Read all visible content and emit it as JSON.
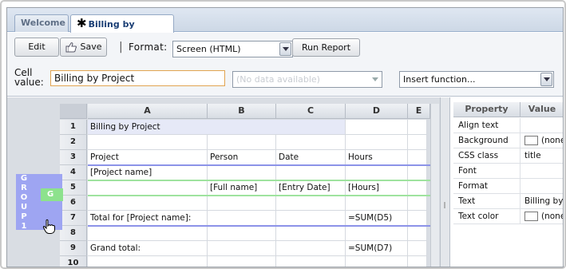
{
  "tabs": [
    {
      "label": "Welcome",
      "active": false
    },
    {
      "label": "Billing by Project",
      "active": true,
      "modified": true
    }
  ],
  "toolbar": {
    "edit_label": "Edit",
    "save_label": "Save",
    "separator": "|",
    "format_label": "Format:",
    "format_value": "Screen (HTML)",
    "run_label": "Run Report"
  },
  "cell_value": {
    "label_line1": "Cell",
    "label_line2": "value:",
    "value": "Billing by Project",
    "data_select": "(No data available)",
    "insert_function": "Insert function..."
  },
  "grid": {
    "columns": [
      "A",
      "B",
      "C",
      "D",
      "E"
    ],
    "rows": [
      "1",
      "2",
      "3",
      "4",
      "5",
      "6",
      "7",
      "8",
      "9",
      "10"
    ],
    "cells": {
      "r1a": "Billing by Project",
      "r3a": "Project",
      "r3b": "Person",
      "r3c": "Date",
      "r3d": "Hours",
      "r4a": "[Project name]",
      "r5b": "[Full name]",
      "r5c": "[Entry Date]",
      "r5d": "[Hours]",
      "r7a": "Total for [Project name]:",
      "r7d": "=SUM(D5)",
      "r9a": "Grand total:",
      "r9d": "=SUM(D7)"
    },
    "group_label": "G\nR\nO\nU\nP\n1",
    "inner_group_label": "G"
  },
  "properties": {
    "header_property": "Property",
    "header_value": "Value",
    "rows": [
      {
        "name": "Align text",
        "value": ""
      },
      {
        "name": "Background",
        "value": "(none)"
      },
      {
        "name": "CSS class",
        "value": "title"
      },
      {
        "name": "Font",
        "value": ""
      },
      {
        "name": "Format",
        "value": ""
      },
      {
        "name": "Text",
        "value": "Billing by Project"
      },
      {
        "name": "Text color",
        "value": "(none)"
      }
    ]
  },
  "colors": {
    "group_blue": "#9ea5f2",
    "group_green": "#8de28d",
    "input_border": "#e1a451"
  }
}
